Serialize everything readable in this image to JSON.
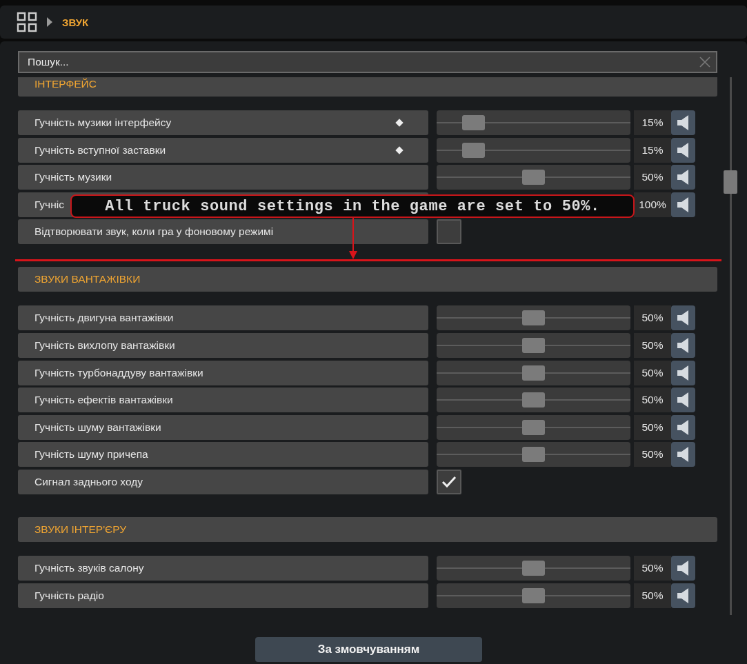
{
  "header": {
    "breadcrumb": "ЗВУК"
  },
  "search": {
    "placeholder": "Пошук..."
  },
  "sections": [
    {
      "title": "ІНТЕРФЕЙС",
      "rows": [
        {
          "kind": "slider",
          "label": "Гучність музики інтерфейсу",
          "modified": true,
          "level": 0.15,
          "reading": "15%"
        },
        {
          "kind": "slider",
          "label": "Гучність вступної заставки",
          "modified": true,
          "level": 0.15,
          "reading": "15%"
        },
        {
          "kind": "slider",
          "label": "Гучність музики",
          "modified": false,
          "level": 0.5,
          "reading": "50%"
        },
        {
          "kind": "slider",
          "label": "Гучніс",
          "reading": "100%"
        },
        {
          "kind": "checkbox",
          "label": "Відтворювати звук, коли гра у фоновому режимі",
          "checked": false
        }
      ]
    },
    {
      "title": "ЗВУКИ ВАНТАЖІВКИ",
      "rows": [
        {
          "kind": "slider",
          "label": "Гучність двигуна вантажівки",
          "modified": false,
          "level": 0.5,
          "reading": "50%"
        },
        {
          "kind": "slider",
          "label": "Гучність вихлопу вантажівки",
          "modified": false,
          "level": 0.5,
          "reading": "50%"
        },
        {
          "kind": "slider",
          "label": "Гучність турбонаддуву вантажівки",
          "modified": false,
          "level": 0.5,
          "reading": "50%"
        },
        {
          "kind": "slider",
          "label": "Гучність ефектів вантажівки",
          "modified": false,
          "level": 0.5,
          "reading": "50%"
        },
        {
          "kind": "slider",
          "label": "Гучність шуму вантажівки",
          "modified": false,
          "level": 0.5,
          "reading": "50%"
        },
        {
          "kind": "slider",
          "label": "Гучність шуму причепа",
          "modified": false,
          "level": 0.5,
          "reading": "50%"
        },
        {
          "kind": "checkbox",
          "label": "Сигнал заднього ходу",
          "checked": true
        }
      ]
    },
    {
      "title": "ЗВУКИ ІНТЕР'ЄРУ",
      "rows": [
        {
          "kind": "slider",
          "label": "Гучність звуків салону",
          "modified": false,
          "level": 0.5,
          "reading": "50%"
        },
        {
          "kind": "slider",
          "label": "Гучність радіо",
          "modified": false,
          "level": 0.5,
          "reading": "50%"
        }
      ]
    }
  ],
  "annotation": {
    "text": "All truck sound settings in the game are set to 50%."
  },
  "footer": {
    "button": "За змовчуванням"
  }
}
